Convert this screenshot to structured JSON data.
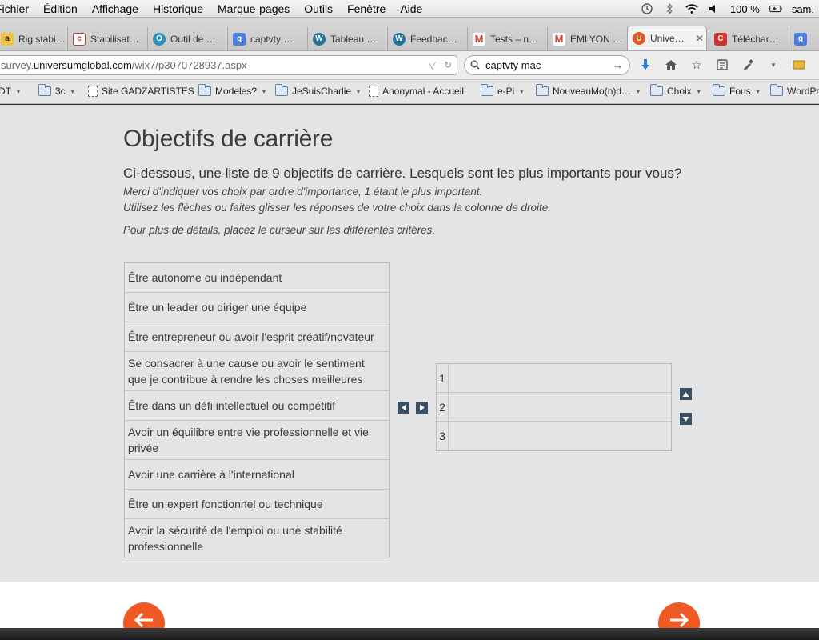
{
  "menubar": {
    "items": [
      "Fichier",
      "Édition",
      "Affichage",
      "Historique",
      "Marque-pages",
      "Outils",
      "Fenêtre",
      "Aide"
    ],
    "battery": "100 %",
    "user": "sam."
  },
  "tabs": [
    {
      "label": "Rig stabi…",
      "icon": "amazon-icon",
      "color": "#222222"
    },
    {
      "label": "Stabilisat…",
      "icon": "site-icon",
      "color": "#c0392b"
    },
    {
      "label": "Outil de …",
      "icon": "site-icon",
      "color": "#2a8fbd"
    },
    {
      "label": "captvty …",
      "icon": "google-icon",
      "color": "#4a7de0"
    },
    {
      "label": "Tableau …",
      "icon": "wordpress-icon",
      "color": "#21759b"
    },
    {
      "label": "Feedbac…",
      "icon": "wordpress-icon",
      "color": "#21759b"
    },
    {
      "label": "Tests – n…",
      "icon": "gmail-icon",
      "color": "#d44638"
    },
    {
      "label": "EMLYON …",
      "icon": "gmail-icon",
      "color": "#d44638"
    },
    {
      "label": "Unive…",
      "icon": "universum-icon",
      "color": "#e8561e"
    },
    {
      "label": "Téléchar…",
      "icon": "site-icon",
      "color": "#d0312d"
    },
    {
      "label": "",
      "icon": "google-icon",
      "color": "#4a7de0"
    }
  ],
  "url": {
    "prefix": "survey.",
    "host": "universumglobal.com",
    "path": "/wix7/p3070728937.aspx"
  },
  "search": {
    "value": "captvty mac"
  },
  "bookmarks": [
    {
      "label": "DT",
      "type": "folder"
    },
    {
      "label": "3c",
      "type": "folder"
    },
    {
      "label": "Site GADZARTISTES",
      "type": "page"
    },
    {
      "label": "Modeles?",
      "type": "folder"
    },
    {
      "label": "JeSuisCharlie",
      "type": "folder"
    },
    {
      "label": "Anonymal - Accueil",
      "type": "page"
    },
    {
      "label": "e-Pi",
      "type": "folder"
    },
    {
      "label": "NouveauMo(n)d…",
      "type": "folder"
    },
    {
      "label": "Choix",
      "type": "folder"
    },
    {
      "label": "Fous",
      "type": "folder"
    },
    {
      "label": "WordPre",
      "type": "folder"
    }
  ],
  "survey": {
    "title": "Objectifs de carrière",
    "question": "Ci-dessous, une liste de 9 objectifs de carrière. Lesquels sont les plus importants pour vous?",
    "note1": "Merci d'indiquer vos choix par ordre d'importance, 1 étant le plus important.",
    "note2": "Utilisez les flèches ou faites glisser les réponses de votre choix dans la colonne de droite.",
    "note3": "Pour plus de détails, placez le curseur sur les différentes critères.",
    "options": [
      "Être autonome ou indépendant",
      "Être un leader ou diriger une équipe",
      "Être entrepreneur ou avoir l'esprit créatif/novateur",
      "Se consacrer à une cause ou avoir le sentiment que je contribue à rendre les choses meilleures",
      "Être dans un défi intellectuel ou compétitif",
      "Avoir un équilibre entre vie professionnelle et vie privée",
      "Avoir une carrière à l'international",
      "Être un expert fonctionnel ou technique",
      "Avoir la sécurité de l'emploi ou une stabilité professionnelle"
    ],
    "ranks": [
      "1",
      "2",
      "3"
    ]
  },
  "colors": {
    "accent": "#ef5a24",
    "arrow_button": "#3b4f62",
    "page_bg": "#e3e4e6"
  }
}
